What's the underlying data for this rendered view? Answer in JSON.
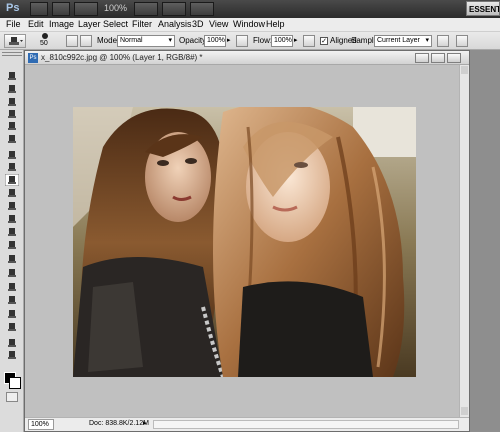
{
  "app": {
    "logo": "Ps",
    "zoom": "100%",
    "workspace": "ESSENTIA"
  },
  "menu": [
    "File",
    "Edit",
    "Image",
    "Layer",
    "Select",
    "Filter",
    "Analysis",
    "3D",
    "View",
    "Window",
    "Help"
  ],
  "options": {
    "brush_size": "50",
    "mode_label": "Mode:",
    "mode_value": "Normal",
    "opacity_label": "Opacity:",
    "opacity_value": "100%",
    "flow_label": "Flow:",
    "flow_value": "100%",
    "aligned_label": "Aligned",
    "sample_label": "Sample:",
    "sample_value": "Current Layer"
  },
  "document": {
    "title": "x_810c992c.jpg @ 100% (Layer 1, RGB/8#) *",
    "zoom": "100%",
    "doc_size": "Doc: 838.8K/2.12M"
  },
  "tools": [
    "move-tool-icon",
    "marquee-tool-icon",
    "lasso-tool-icon",
    "quick-select-tool-icon",
    "crop-tool-icon",
    "eyedropper-tool-icon",
    "healing-brush-tool-icon",
    "brush-tool-icon",
    "clone-stamp-tool-icon",
    "history-brush-tool-icon",
    "eraser-tool-icon",
    "gradient-tool-icon",
    "blur-tool-icon",
    "dodge-tool-icon",
    "pen-tool-icon",
    "type-tool-icon",
    "path-select-tool-icon",
    "shape-tool-icon",
    "3d-rotate-tool-icon",
    "3d-orbit-tool-icon",
    "hand-tool-icon",
    "zoom-tool-icon"
  ]
}
